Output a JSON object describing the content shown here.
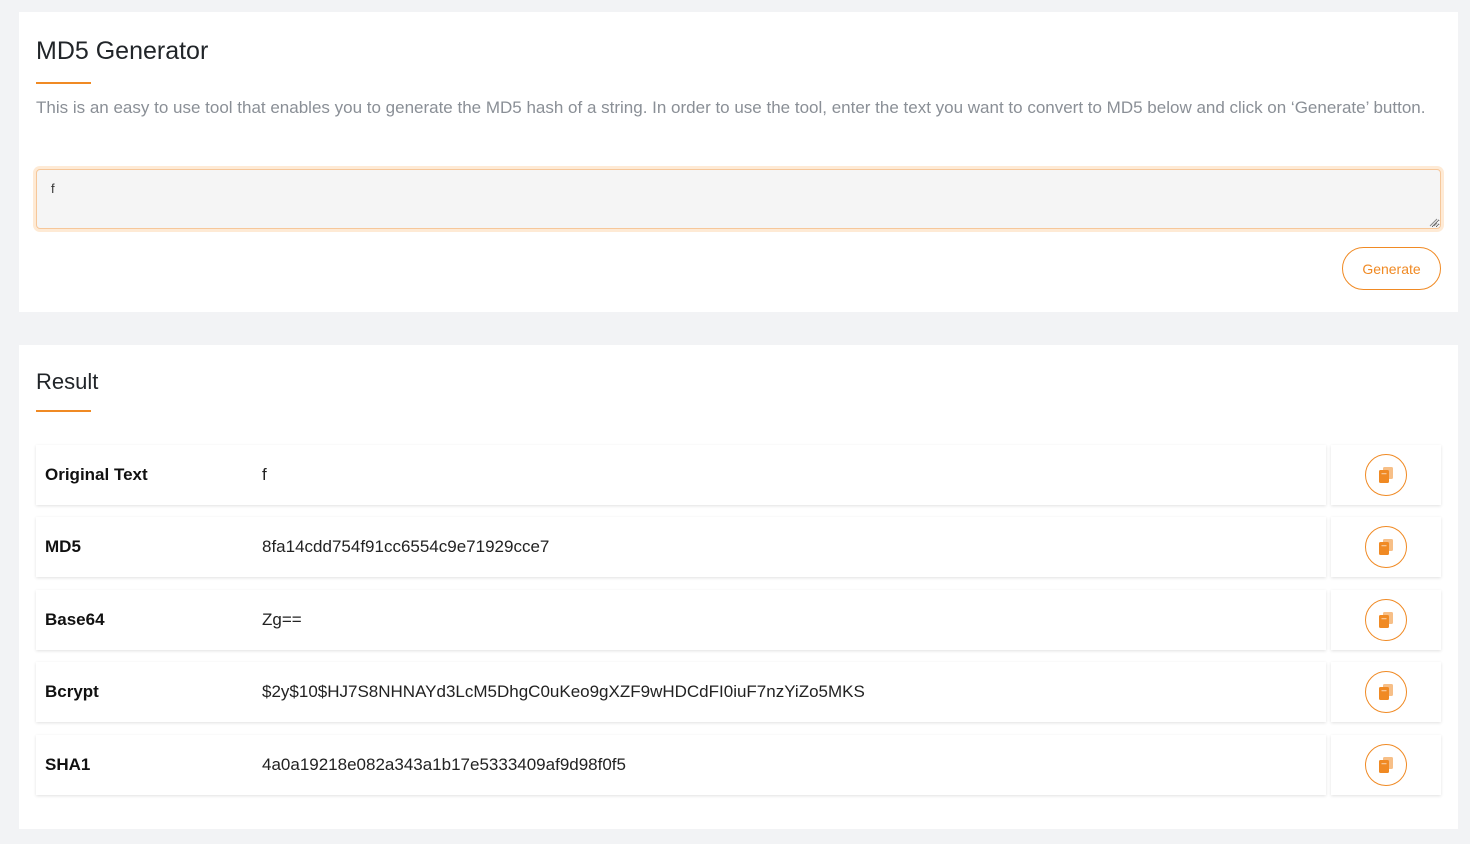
{
  "generator": {
    "title": "MD5 Generator",
    "description": "This is an easy to use tool that enables you to generate the MD5 hash of a string. In order to use the tool, enter the text you want to convert to MD5 below and click on ‘Generate’ button.",
    "input_value": "f",
    "generate_label": "Generate"
  },
  "result": {
    "title": "Result",
    "rows": [
      {
        "label": "Original Text",
        "value": "f"
      },
      {
        "label": "MD5",
        "value": "8fa14cdd754f91cc6554c9e71929cce7"
      },
      {
        "label": "Base64",
        "value": "Zg=="
      },
      {
        "label": "Bcrypt",
        "value": "$2y$10$HJ7S8NHNAYd3LcM5DhgC0uKeo9gXZF9wHDCdFI0iuF7nzYiZo5MKS"
      },
      {
        "label": "SHA1",
        "value": "4a0a19218e082a343a1b17e5333409af9d98f0f5"
      }
    ]
  },
  "icons": {
    "copy": "copy-icon",
    "resize": "resize-grip-icon"
  },
  "colors": {
    "accent": "#f08a24",
    "background": "#f2f3f5",
    "card": "#ffffff",
    "muted_text": "#8a8f96"
  }
}
